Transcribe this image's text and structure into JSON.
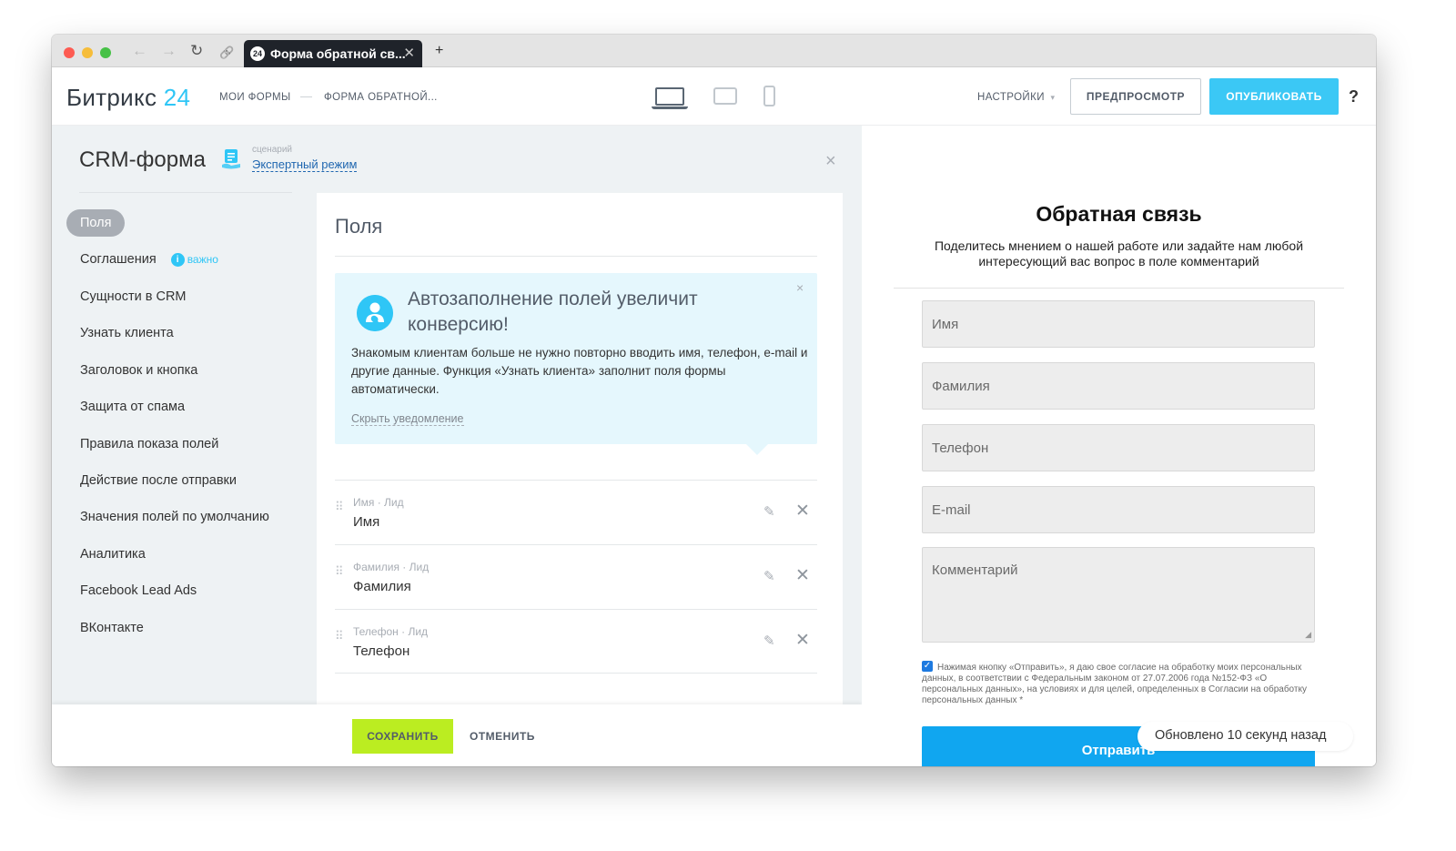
{
  "browser": {
    "tab_badge": "24",
    "tab_title": "Форма обратной св...",
    "tab_close": "✕",
    "new_tab": "+",
    "back": "←",
    "forward": "→",
    "reload": "↻",
    "link": "🔗"
  },
  "header": {
    "logo_text": "Битрикс",
    "logo_num": "24",
    "breadcrumbs": [
      "МОИ ФОРМЫ",
      "ФОРМА ОБРАТНОЙ..."
    ],
    "crumb_separator": "—",
    "devices": [
      "laptop-icon",
      "tablet-icon",
      "phone-icon"
    ],
    "active_device": "laptop",
    "settings_label": "НАСТРОЙКИ",
    "settings_caret": "▾",
    "preview_label": "ПРЕДПРОСМОТР",
    "publish_label": "ОПУБЛИКОВАТЬ",
    "help_label": "?"
  },
  "editor": {
    "title": "CRM-форма",
    "scenario_caption": "сценарий",
    "scenario_value": "Экспертный режим",
    "close": "×",
    "sidebar": [
      {
        "label": "Поля",
        "active": true
      },
      {
        "label": "Соглашения",
        "badge": "важно"
      },
      {
        "label": "Сущности в CRM"
      },
      {
        "label": "Узнать клиента"
      },
      {
        "label": "Заголовок и кнопка"
      },
      {
        "label": "Защита от спама"
      },
      {
        "label": "Правила показа полей"
      },
      {
        "label": "Действие после отправки"
      },
      {
        "label": "Значения полей по умолчанию"
      },
      {
        "label": "Аналитика"
      },
      {
        "label": "Facebook Lead Ads"
      },
      {
        "label": "ВКонтакте"
      }
    ],
    "important_icon": "i",
    "fields_title": "Поля",
    "notice": {
      "title": "Автозаполнение полей увеличит конверсию!",
      "text": "Знакомым клиентам больше не нужно повторно вводить имя, телефон, e-mail и другие данные. Функция «Узнать клиента» заполнит поля формы автоматически.",
      "hide_label": "Скрыть уведомление",
      "close": "×"
    },
    "fields": [
      {
        "caption": "Имя · Лид",
        "name": "Имя"
      },
      {
        "caption": "Фамилия · Лид",
        "name": "Фамилия"
      },
      {
        "caption": "Телефон · Лид",
        "name": "Телефон"
      }
    ],
    "drag_glyph": "⠿",
    "edit_glyph": "✎",
    "delete_glyph": "✕",
    "save_label": "СОХРАНИТЬ",
    "cancel_label": "ОТМЕНИТЬ"
  },
  "preview": {
    "title": "Обратная связь",
    "subtitle": "Поделитесь мнением о нашей работе или задайте нам любой интересующий вас вопрос в поле комментарий",
    "inputs": [
      "Имя",
      "Фамилия",
      "Телефон",
      "E-mail"
    ],
    "comment_placeholder": "Комментарий",
    "consent_checked": true,
    "consent_text": "Нажимая кнопку «Отправить», я даю свое согласие на обработку моих персональных данных, в соответствии с Федеральным законом от 27.07.2006 года №152-ФЗ «О персональных данных», на условиях и для целей, определенных в Согласии на обработку персональных данных *",
    "submit_label": "Отправить",
    "updated_toast": "Обновлено 10 секунд назад",
    "check_glyph": "✓",
    "resize_glyph": "◢"
  },
  "colors": {
    "accent": "#2fc6f6",
    "publish": "#3bc8f5",
    "save": "#bbed21",
    "submit": "#10a6f0",
    "notice_bg": "#e5f7fd"
  }
}
